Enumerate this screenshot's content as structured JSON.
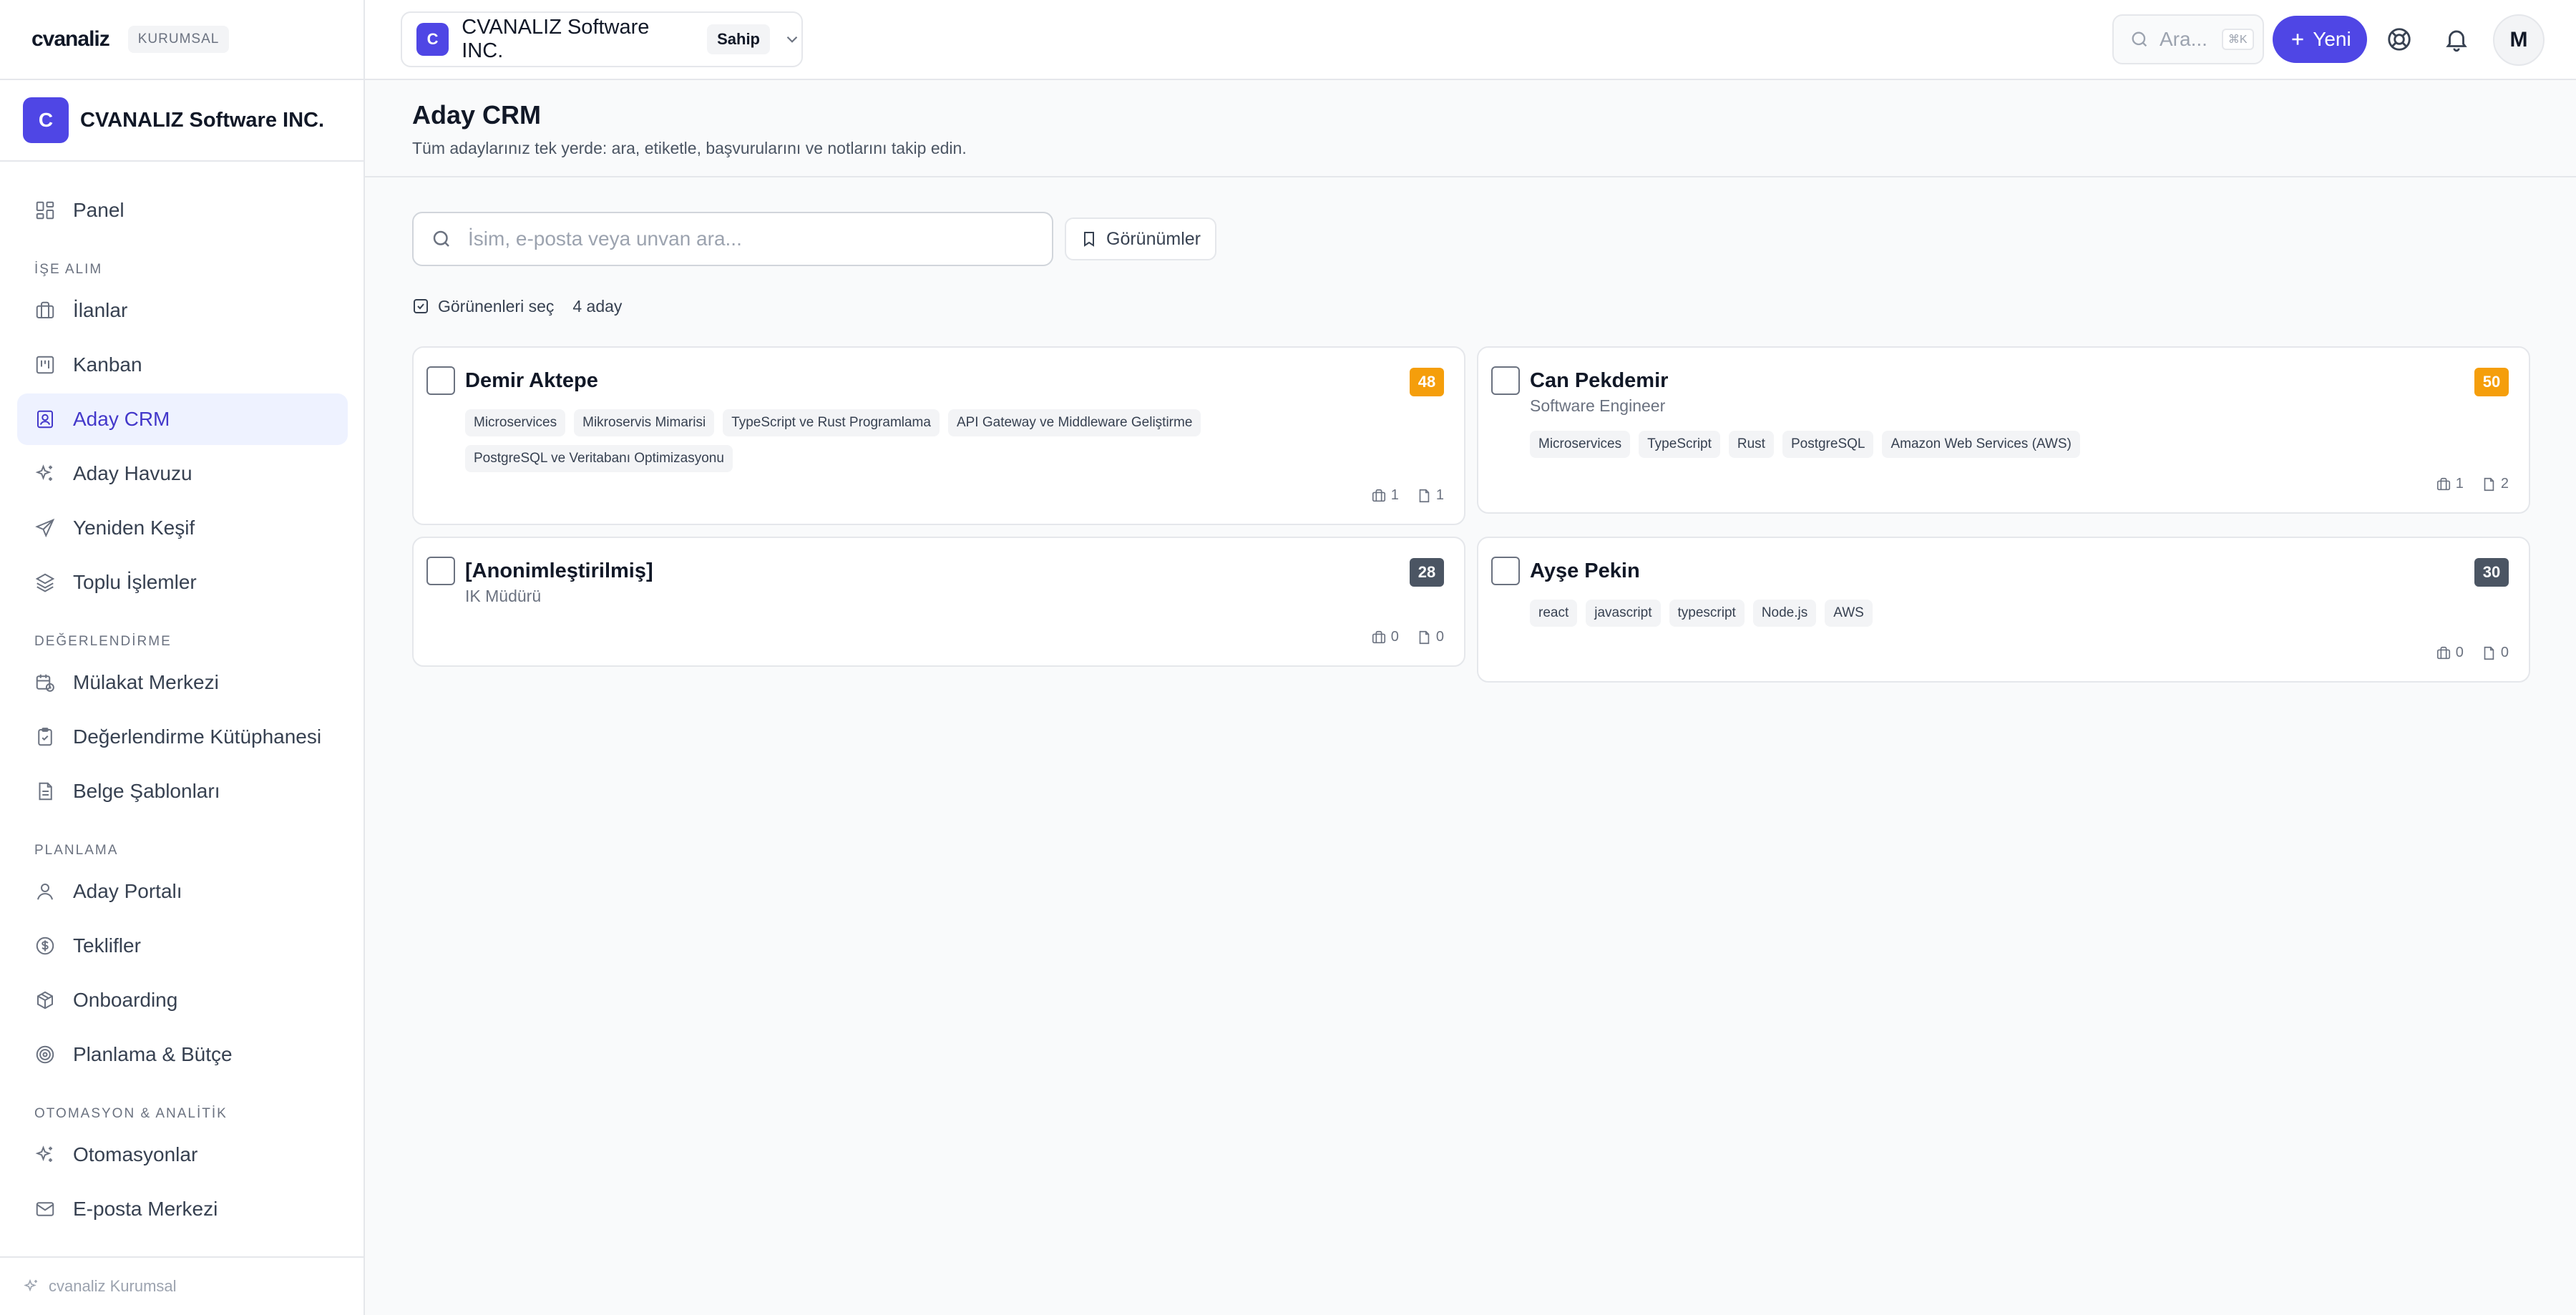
{
  "brand": {
    "logo": "cvanaliz",
    "badge": "KURUMSAL"
  },
  "org": {
    "initial": "C",
    "name": "CVANALIZ Software INC."
  },
  "topbar": {
    "org_initial": "C",
    "org_name": "CVANALIZ Software INC.",
    "role": "Sahip",
    "search_placeholder": "Ara...",
    "search_shortcut": "⌘K",
    "new_label": "Yeni",
    "user_initial": "M"
  },
  "sidebar": {
    "panel": "Panel",
    "section_recruiting": "İŞE ALIM",
    "ilanlar": "İlanlar",
    "kanban": "Kanban",
    "aday_crm": "Aday CRM",
    "aday_havuzu": "Aday Havuzu",
    "yeniden_kesif": "Yeniden Keşif",
    "toplu_islemler": "Toplu İşlemler",
    "section_evaluation": "DEĞERLENDİRME",
    "mulakat_merkezi": "Mülakat Merkezi",
    "degerlendirme_kutuphanesi": "Değerlendirme Kütüphanesi",
    "belge_sablonlari": "Belge Şablonları",
    "section_planning": "PLANLAMA",
    "aday_portali": "Aday Portalı",
    "teklifler": "Teklifler",
    "onboarding": "Onboarding",
    "planlama_butce": "Planlama & Bütçe",
    "section_automation": "OTOMASYON & ANALİTİK",
    "otomasyonlar": "Otomasyonlar",
    "eposta_merkezi": "E-posta Merkezi",
    "footer": "cvanaliz Kurumsal"
  },
  "page": {
    "title": "Aday CRM",
    "subtitle": "Tüm adaylarınız tek yerde: ara, etiketle, başvurularını ve notlarını takip edin.",
    "search_placeholder": "İsim, e-posta veya unvan ara...",
    "views_label": "Görünümler",
    "select_visible": "Görünenleri seç",
    "count": "4 aday"
  },
  "candidates": [
    {
      "name": "Demir Aktepe",
      "title": "",
      "score": "48",
      "tags": [
        "Microservices",
        "Mikroservis Mimarisi",
        "TypeScript ve Rust Programlama",
        "API Gateway ve Middleware Geliştirme",
        "PostgreSQL ve Veritabanı Optimizasyonu"
      ],
      "applications": "1",
      "notes": "1"
    },
    {
      "name": "Can Pekdemir",
      "title": "Software Engineer",
      "score": "50",
      "tags": [
        "Microservices",
        "TypeScript",
        "Rust",
        "PostgreSQL",
        "Amazon Web Services (AWS)"
      ],
      "applications": "1",
      "notes": "2"
    },
    {
      "name": "[Anonimleştirilmiş]",
      "title": "IK Müdürü",
      "score": "28",
      "tags": [],
      "applications": "0",
      "notes": "0"
    },
    {
      "name": "Ayşe Pekin",
      "title": "",
      "score": "30",
      "tags": [
        "react",
        "javascript",
        "typescript",
        "Node.js",
        "AWS"
      ],
      "applications": "0",
      "notes": "0"
    }
  ],
  "colors": {
    "accent": "#4f46e5",
    "score_high": "#f59e0b",
    "score_low": "#4b5563"
  }
}
